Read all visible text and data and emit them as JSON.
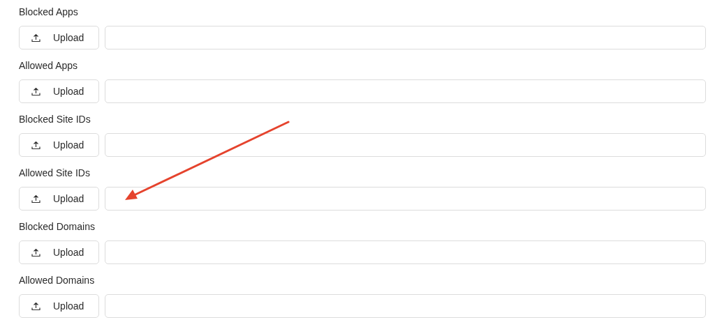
{
  "fields": [
    {
      "label": "Blocked Apps",
      "button": "Upload"
    },
    {
      "label": "Allowed Apps",
      "button": "Upload"
    },
    {
      "label": "Blocked Site IDs",
      "button": "Upload"
    },
    {
      "label": "Allowed Site IDs",
      "button": "Upload"
    },
    {
      "label": "Blocked Domains",
      "button": "Upload"
    },
    {
      "label": "Allowed Domains",
      "button": "Upload"
    }
  ],
  "annotation": {
    "kind": "arrow",
    "color": "#e5432d"
  }
}
